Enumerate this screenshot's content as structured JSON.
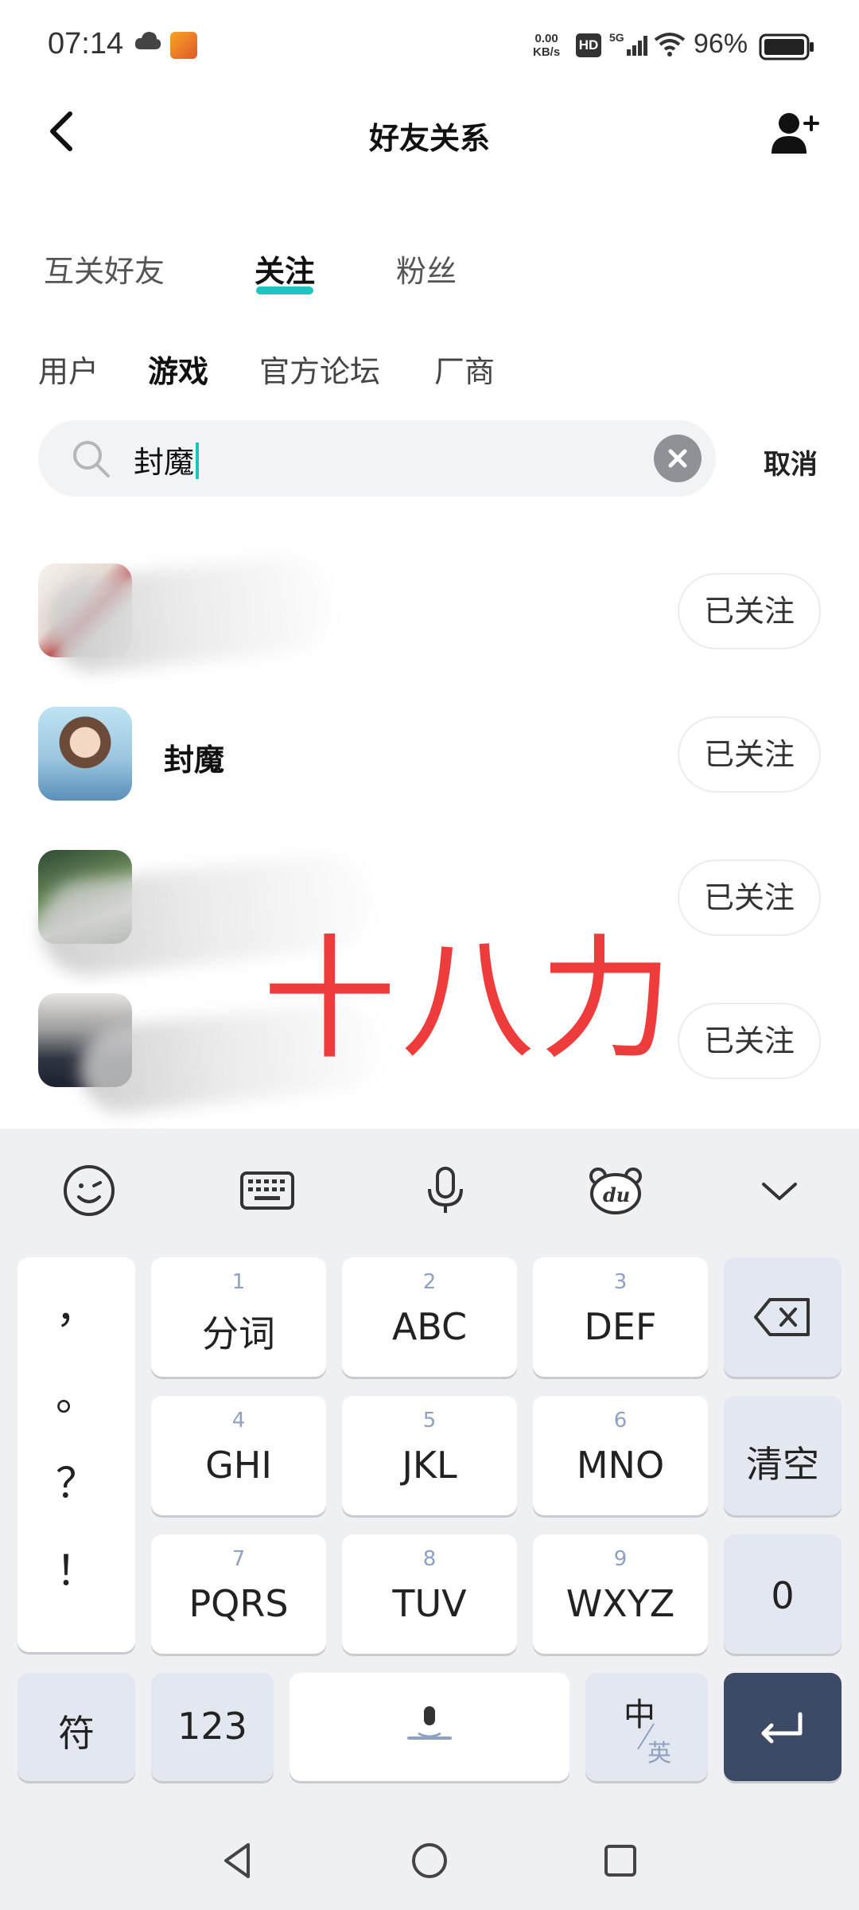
{
  "status": {
    "time": "07:14",
    "speed_value": "0.00",
    "speed_unit": "KB/s",
    "hd_label": "HD",
    "network": "5G",
    "battery": "96%"
  },
  "header": {
    "title": "好友关系"
  },
  "tabs": [
    {
      "label": "互关好友"
    },
    {
      "label": "关注"
    },
    {
      "label": "粉丝"
    }
  ],
  "subtabs": [
    {
      "label": "用户"
    },
    {
      "label": "游戏"
    },
    {
      "label": "官方论坛"
    },
    {
      "label": "厂商"
    }
  ],
  "search": {
    "value": "封魔",
    "cancel_label": "取消"
  },
  "results": [
    {
      "name": "",
      "button": "已关注"
    },
    {
      "name": "封魔",
      "button": "已关注"
    },
    {
      "name": "",
      "button": "已关注"
    },
    {
      "name": "",
      "button": "已关注"
    }
  ],
  "watermark": "十八力",
  "keyboard": {
    "punctuation": [
      "，",
      "。",
      "？",
      "！"
    ],
    "keys": [
      {
        "num": "1",
        "label": "分词"
      },
      {
        "num": "2",
        "label": "ABC"
      },
      {
        "num": "3",
        "label": "DEF"
      },
      {
        "num": "4",
        "label": "GHI"
      },
      {
        "num": "5",
        "label": "JKL"
      },
      {
        "num": "6",
        "label": "MNO"
      },
      {
        "num": "7",
        "label": "PQRS"
      },
      {
        "num": "8",
        "label": "TUV"
      },
      {
        "num": "9",
        "label": "WXYZ"
      }
    ],
    "clear_label": "清空",
    "zero_label": "0",
    "symbol_label": "符",
    "numeric_label": "123",
    "lang_primary": "中",
    "lang_secondary": "英",
    "toolbar_logo": "du"
  },
  "colors": {
    "accent": "#1ec5c0",
    "watermark": "#ee3b3b",
    "enter_key": "#3d4a66"
  }
}
